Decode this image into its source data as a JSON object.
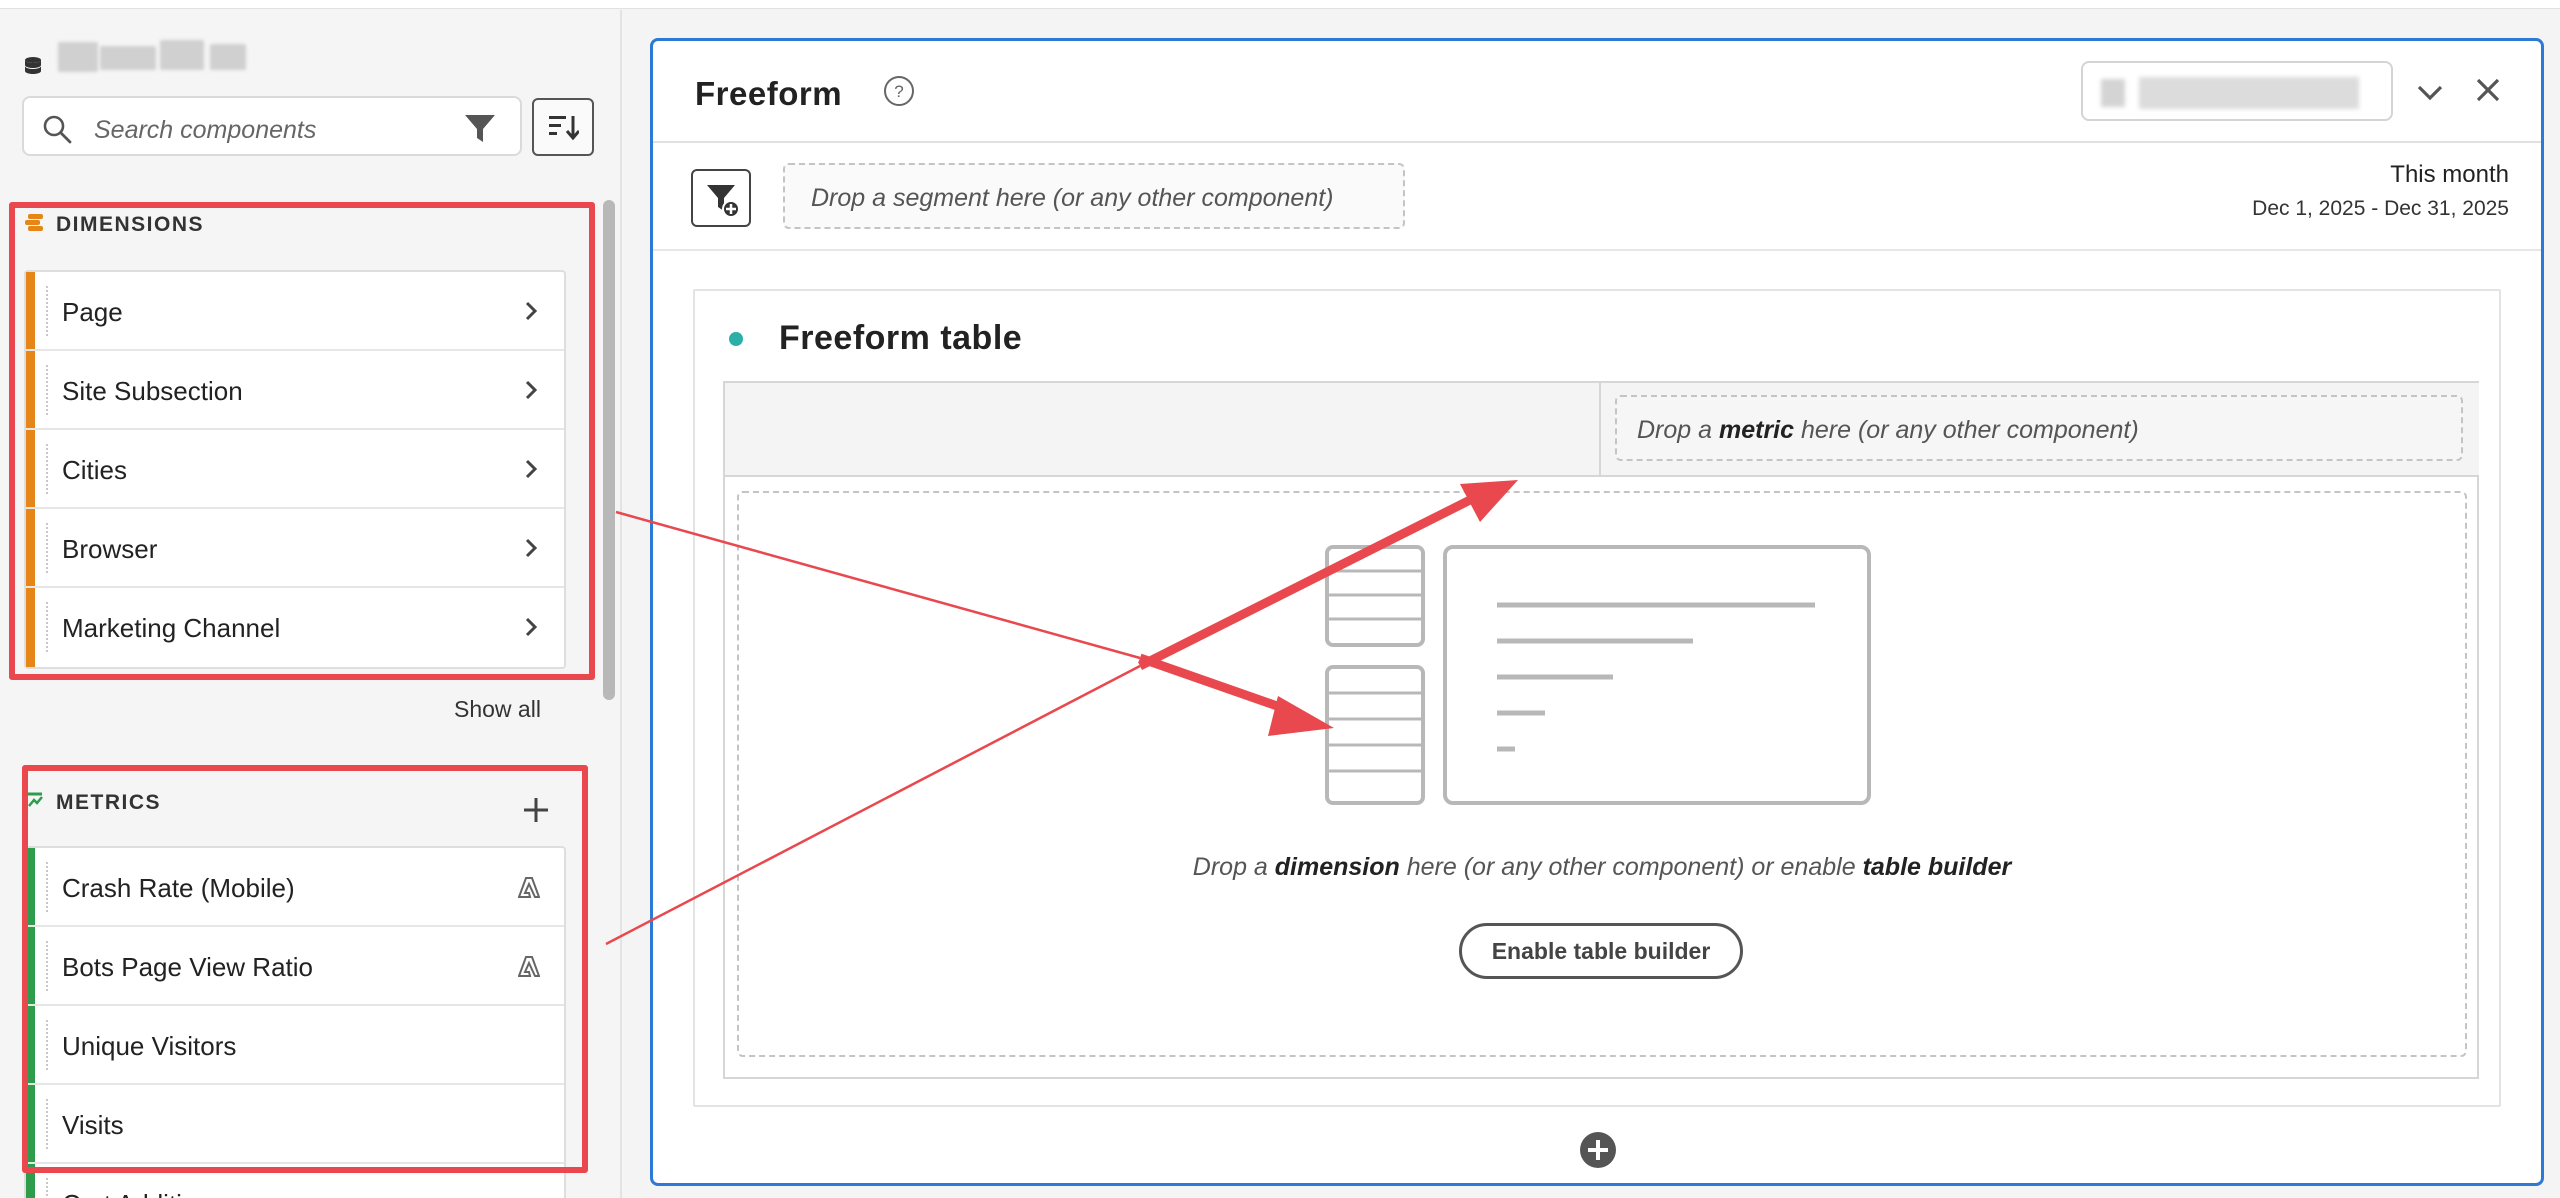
{
  "rail": {
    "search": {
      "placeholder": "Search components"
    },
    "dimensions": {
      "title": "DIMENSIONS",
      "items": [
        "Page",
        "Site Subsection",
        "Cities",
        "Browser",
        "Marketing Channel"
      ],
      "show_all": "Show all"
    },
    "metrics": {
      "title": "METRICS",
      "items": [
        "Crash Rate (Mobile)",
        "Bots Page View Ratio",
        "Unique Visitors",
        "Visits",
        "Cart Additions"
      ]
    }
  },
  "panel": {
    "title": "Freeform",
    "segment_drop": "Drop a segment here (or any other component)",
    "date_label": "This month",
    "date_range": "Dec 1, 2025 - Dec 31, 2025",
    "viz": {
      "title": "Freeform table",
      "metric_drop": {
        "pre": "Drop a ",
        "emph": "metric",
        "post": " here (or any other component)"
      },
      "dimension_drop": {
        "pre": "Drop a ",
        "emph1": "dimension",
        "mid": " here (or any other component) or enable ",
        "emph2": "table builder"
      },
      "enable_button": "Enable table builder"
    }
  },
  "colors": {
    "dimension_accent": "#e68619",
    "metric_accent": "#2d9d4c",
    "panel_border": "#2d7ad6",
    "annotation_red": "#e8484e",
    "viz_dot": "#2ab0a8"
  },
  "icons": [
    "database-icon",
    "search-icon",
    "filter-icon",
    "sort-icon",
    "chevron-right-icon",
    "adobe-icon",
    "plus-icon",
    "help-icon",
    "chevron-down-icon",
    "close-icon",
    "segment-filter-icon",
    "add-circle-icon"
  ]
}
